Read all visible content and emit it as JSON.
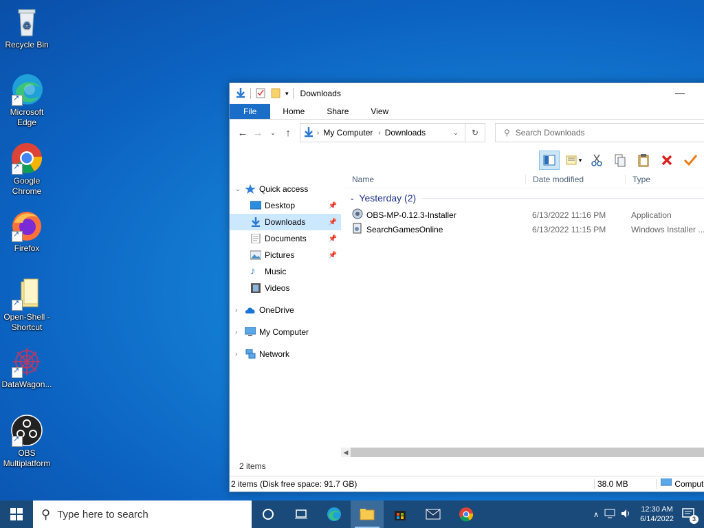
{
  "desktop": {
    "icons": [
      {
        "label": "Recycle Bin"
      },
      {
        "label": "Microsoft Edge"
      },
      {
        "label": "Google Chrome"
      },
      {
        "label": "Firefox"
      },
      {
        "label": "Open-Shell - Shortcut"
      },
      {
        "label": "DataWagon..."
      },
      {
        "label": "OBS Multiplatform"
      }
    ]
  },
  "window": {
    "title": "Downloads",
    "minimize_glyph": "—",
    "ribbon_tabs": [
      "File",
      "Home",
      "Share",
      "View"
    ],
    "address": {
      "root": "My Computer",
      "current": "Downloads"
    },
    "search_placeholder": "Search Downloads",
    "nav": {
      "quick_access": "Quick access",
      "items": [
        "Desktop",
        "Downloads",
        "Documents",
        "Pictures",
        "Music",
        "Videos"
      ],
      "onedrive": "OneDrive",
      "my_computer": "My Computer",
      "network": "Network"
    },
    "columns": {
      "name": "Name",
      "date": "Date modified",
      "type": "Type"
    },
    "group": "Yesterday (2)",
    "files": [
      {
        "name": "OBS-MP-0.12.3-Installer",
        "date": "6/13/2022 11:16 PM",
        "type": "Application"
      },
      {
        "name": "SearchGamesOnline",
        "date": "6/13/2022 11:15 PM",
        "type": "Windows Installer ..."
      }
    ],
    "items_count": "2 items",
    "status": {
      "left": "2 items (Disk free space: 91.7 GB)",
      "size": "38.0 MB",
      "location": "Computer"
    }
  },
  "taskbar": {
    "search_placeholder": "Type here to search",
    "time": "12:30 AM",
    "date": "6/14/2022",
    "notifications": "3"
  },
  "colors": {
    "accent": "#1a6ec7",
    "selection": "#cce8ff",
    "group_text": "#1e3287"
  }
}
